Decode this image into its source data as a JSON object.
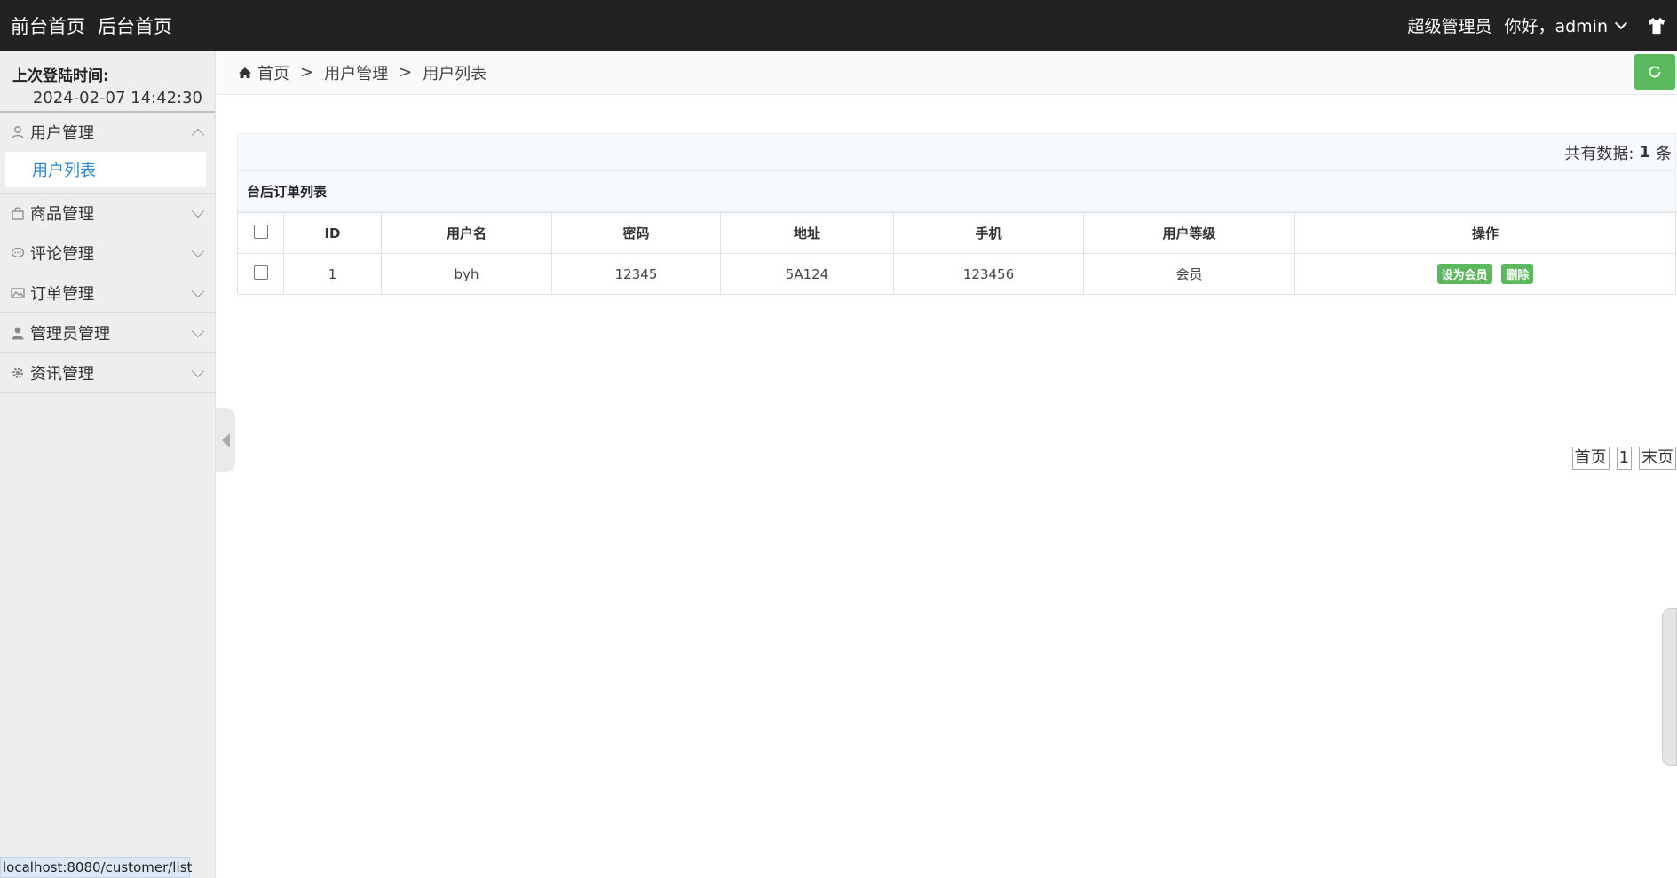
{
  "topbar": {
    "front_home": "前台首页",
    "back_home": "后台首页",
    "role": "超级管理员",
    "greeting": "你好，admin"
  },
  "sidebar": {
    "last_login_label": "上次登陆时间:",
    "last_login_value": "2024-02-07 14:42:30",
    "groups": [
      {
        "label": "用户管理",
        "icon": "user-outline-icon",
        "expanded": true,
        "children": [
          "用户列表"
        ]
      },
      {
        "label": "商品管理",
        "icon": "bag-icon",
        "expanded": false
      },
      {
        "label": "评论管理",
        "icon": "comment-icon",
        "expanded": false
      },
      {
        "label": "订单管理",
        "icon": "image-icon",
        "expanded": false
      },
      {
        "label": "管理员管理",
        "icon": "user-icon",
        "expanded": false
      },
      {
        "label": "资讯管理",
        "icon": "gear-icon",
        "expanded": false
      }
    ]
  },
  "breadcrumb": {
    "home": "首页",
    "level1": "用户管理",
    "level2": "用户列表",
    "separator": ">"
  },
  "summary": {
    "total_label": "共有数据:",
    "total_count": "1",
    "total_unit": "条"
  },
  "table": {
    "title": "台后订单列表",
    "columns": [
      "ID",
      "用户名",
      "密码",
      "地址",
      "手机",
      "用户等级",
      "操作"
    ],
    "rows": [
      {
        "id": "1",
        "username": "byh",
        "password": "12345",
        "address": "5A124",
        "phone": "123456",
        "level": "会员",
        "actions": [
          "设为会员",
          "删除"
        ]
      }
    ]
  },
  "pager": {
    "first": "首页",
    "page": "1",
    "last": "末页"
  },
  "statusbar": {
    "url": "localhost:8080/customer/list"
  },
  "colors": {
    "topbar_bg": "#222222",
    "accent_green": "#5cb85c",
    "link_blue": "#2a8ad4",
    "sidebar_bg": "#eeeeee"
  }
}
